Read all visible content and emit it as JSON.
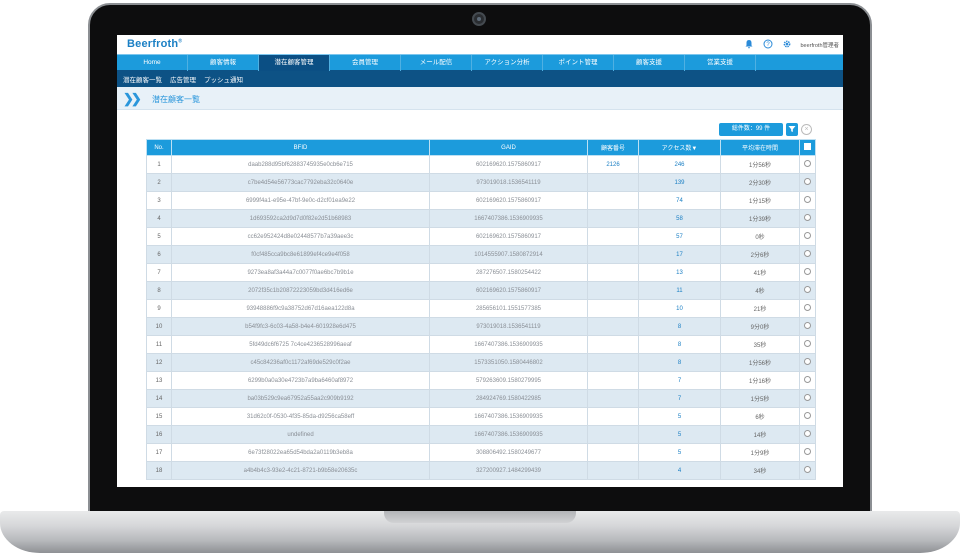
{
  "app": {
    "brand": "Beerfroth",
    "brand_mark": "®",
    "user_label": "beerfroth管理者"
  },
  "nav": {
    "items": [
      "Home",
      "顧客情報",
      "潜在顧客管理",
      "会員管理",
      "メール配信",
      "アクション分析",
      "ポイント管理",
      "顧客支援",
      "営業支援"
    ],
    "active_index": 2
  },
  "subnav": {
    "items": [
      "潜在顧客一覧",
      "広告管理",
      "プッシュ通知"
    ]
  },
  "page": {
    "title": "潜在顧客一覧"
  },
  "toolbar": {
    "count_label": "総件数：99 件"
  },
  "table": {
    "columns": [
      "No.",
      "BFID",
      "GAID",
      "顧客番号",
      "アクセス数▼",
      "平均滞在時間"
    ],
    "rows": [
      {
        "no": "1",
        "bfid": "daab288d95bf62883745935e0cb6e715",
        "gaid": "602169620.1575860917",
        "customer": "2126",
        "access": "246",
        "avg": "1分56秒"
      },
      {
        "no": "2",
        "bfid": "c7be4d54e56773cac7792eba32c0640e",
        "gaid": "973019018.1536541119",
        "customer": "",
        "access": "139",
        "avg": "2分30秒"
      },
      {
        "no": "3",
        "bfid": "6999f4a1-e95e-47bf-9e0c-d2cf01ea9e22",
        "gaid": "602169620.1575860917",
        "customer": "",
        "access": "74",
        "avg": "1分15秒"
      },
      {
        "no": "4",
        "bfid": "1d693592ca2d9d7d0f82e2d51b68983",
        "gaid": "1667407386.1536909935",
        "customer": "",
        "access": "58",
        "avg": "1分39秒"
      },
      {
        "no": "5",
        "bfid": "cc62e952424d8e02448577b7a39aee3c",
        "gaid": "602169620.1575860917",
        "customer": "",
        "access": "57",
        "avg": "0秒"
      },
      {
        "no": "6",
        "bfid": "f0cf485cca9bc8e61899ef4ce9e4f058",
        "gaid": "1014555907.1580872914",
        "customer": "",
        "access": "17",
        "avg": "2分6秒"
      },
      {
        "no": "7",
        "bfid": "9273ea8af3a44a7c0077f0ae6bc7b9b1e",
        "gaid": "287276507.1580254422",
        "customer": "",
        "access": "13",
        "avg": "41秒"
      },
      {
        "no": "8",
        "bfid": "2072f35c1b20872223059bd3d416ed6e",
        "gaid": "602169620.1575860917",
        "customer": "",
        "access": "11",
        "avg": "4秒"
      },
      {
        "no": "9",
        "bfid": "93948886f9c9a38752d67d16aea122d8a",
        "gaid": "285656101.1551577385",
        "customer": "",
        "access": "10",
        "avg": "21秒"
      },
      {
        "no": "10",
        "bfid": "b54f9fc3-6c03-4a58-b4e4-601928e6d475",
        "gaid": "973019018.1536541119",
        "customer": "",
        "access": "8",
        "avg": "9分0秒"
      },
      {
        "no": "11",
        "bfid": "5fd49dc6f6725 7c4ce4236528996aeaf",
        "gaid": "1667407386.1536909935",
        "customer": "",
        "access": "8",
        "avg": "35秒"
      },
      {
        "no": "12",
        "bfid": "c45c84236af0c1172af69de529c0f2ae",
        "gaid": "1573351050.1580446802",
        "customer": "",
        "access": "8",
        "avg": "1分56秒"
      },
      {
        "no": "13",
        "bfid": "6299b0a0a30e4723b7a9ba6460af8972",
        "gaid": "579263609.1580279995",
        "customer": "",
        "access": "7",
        "avg": "1分16秒"
      },
      {
        "no": "14",
        "bfid": "ba03b529c9ea67952a55aa2c909b9192",
        "gaid": "284924769.1580422985",
        "customer": "",
        "access": "7",
        "avg": "1分5秒"
      },
      {
        "no": "15",
        "bfid": "31d62c0f-0530-4f35-85da-d9256ca58eff",
        "gaid": "1667407386.1536909935",
        "customer": "",
        "access": "5",
        "avg": "6秒"
      },
      {
        "no": "16",
        "bfid": "undefined",
        "gaid": "1667407386.1536909935",
        "customer": "",
        "access": "5",
        "avg": "14秒"
      },
      {
        "no": "17",
        "bfid": "6e73f28022ea65d54bda2a0119b3eb8a",
        "gaid": "308806492.1580249677",
        "customer": "",
        "access": "5",
        "avg": "1分9秒"
      },
      {
        "no": "18",
        "bfid": "a4b4b4c3-93e2-4c21-8721-b9b58e20635c",
        "gaid": "327200927.1484299439",
        "customer": "",
        "access": "4",
        "avg": "34秒"
      }
    ]
  },
  "icons": {
    "bell": "bell-icon",
    "help": "help-icon",
    "settings": "gear-icon",
    "filter": "filter-icon",
    "clear": "clear-icon"
  },
  "colors": {
    "accent": "#1c9bdc",
    "nav_active": "#0b4f84",
    "subnav": "#0d5285",
    "row_alt": "#dde9f2"
  }
}
